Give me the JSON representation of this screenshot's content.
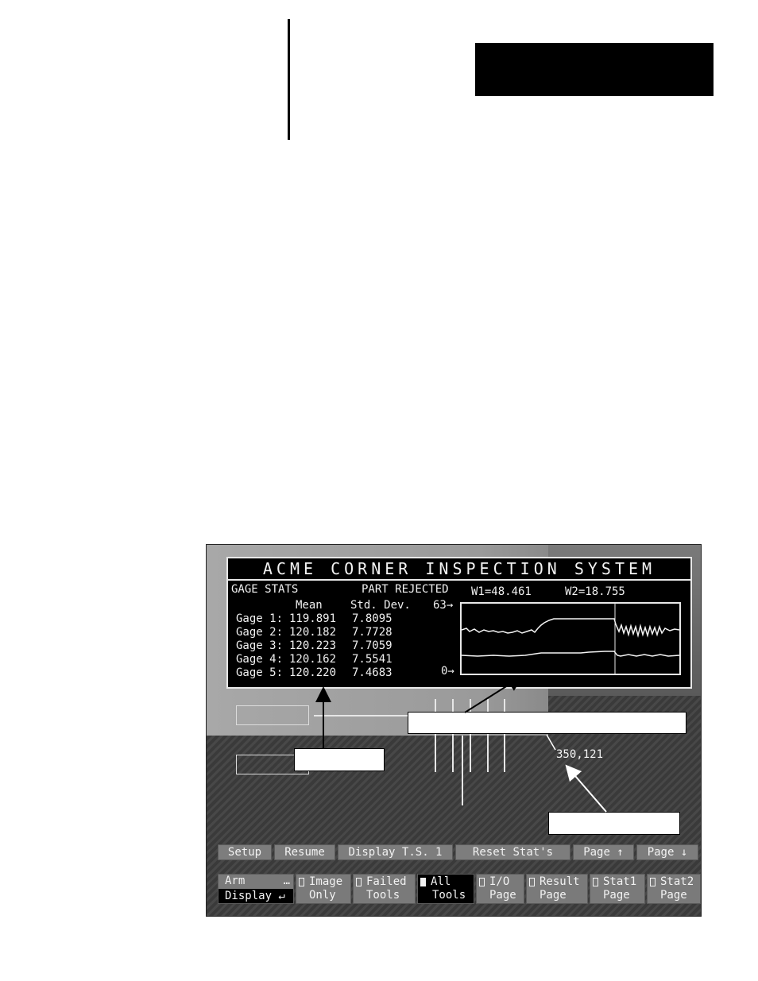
{
  "screen": {
    "panel_title": "ACME CORNER INSPECTION SYSTEM",
    "stats_label": "GAGE STATS",
    "part_status": "PART REJECTED",
    "w1": "W1=48.461",
    "w2": "W2=18.755",
    "col_mean": "Mean",
    "col_sd": "Std. Dev.",
    "scale_max": "63→",
    "scale_min": "0→",
    "gauges": [
      {
        "label": "Gage 1:",
        "mean": "119.891",
        "sd": "7.8095"
      },
      {
        "label": "Gage 2:",
        "mean": "120.182",
        "sd": "7.7728"
      },
      {
        "label": "Gage 3:",
        "mean": "120.223",
        "sd": "7.7059"
      },
      {
        "label": "Gage 4:",
        "mean": "120.162",
        "sd": "7.5541"
      },
      {
        "label": "Gage 5:",
        "mean": "120.220",
        "sd": "7.4683"
      }
    ],
    "coordinate": "350,121"
  },
  "menu": {
    "setup": "Setup",
    "resume": "Resume",
    "display_ts": "Display T.S. 1",
    "reset_stats": "Reset Stat's",
    "page_up": "Page ↑",
    "page_down": "Page ↓"
  },
  "modes": {
    "arm": "Arm",
    "arm_dots": "…",
    "display": "Display ↵",
    "items": [
      {
        "l1": "Image",
        "l2": "Only",
        "active": false
      },
      {
        "l1": "Failed",
        "l2": "Tools",
        "active": false
      },
      {
        "l1": "All",
        "l2": "Tools",
        "active": true
      },
      {
        "l1": "I/O",
        "l2": "Page",
        "active": false
      },
      {
        "l1": "Result",
        "l2": "Page",
        "active": false
      },
      {
        "l1": "Stat1",
        "l2": "Page",
        "active": false
      },
      {
        "l1": "Stat2",
        "l2": "Page",
        "active": false
      }
    ]
  }
}
